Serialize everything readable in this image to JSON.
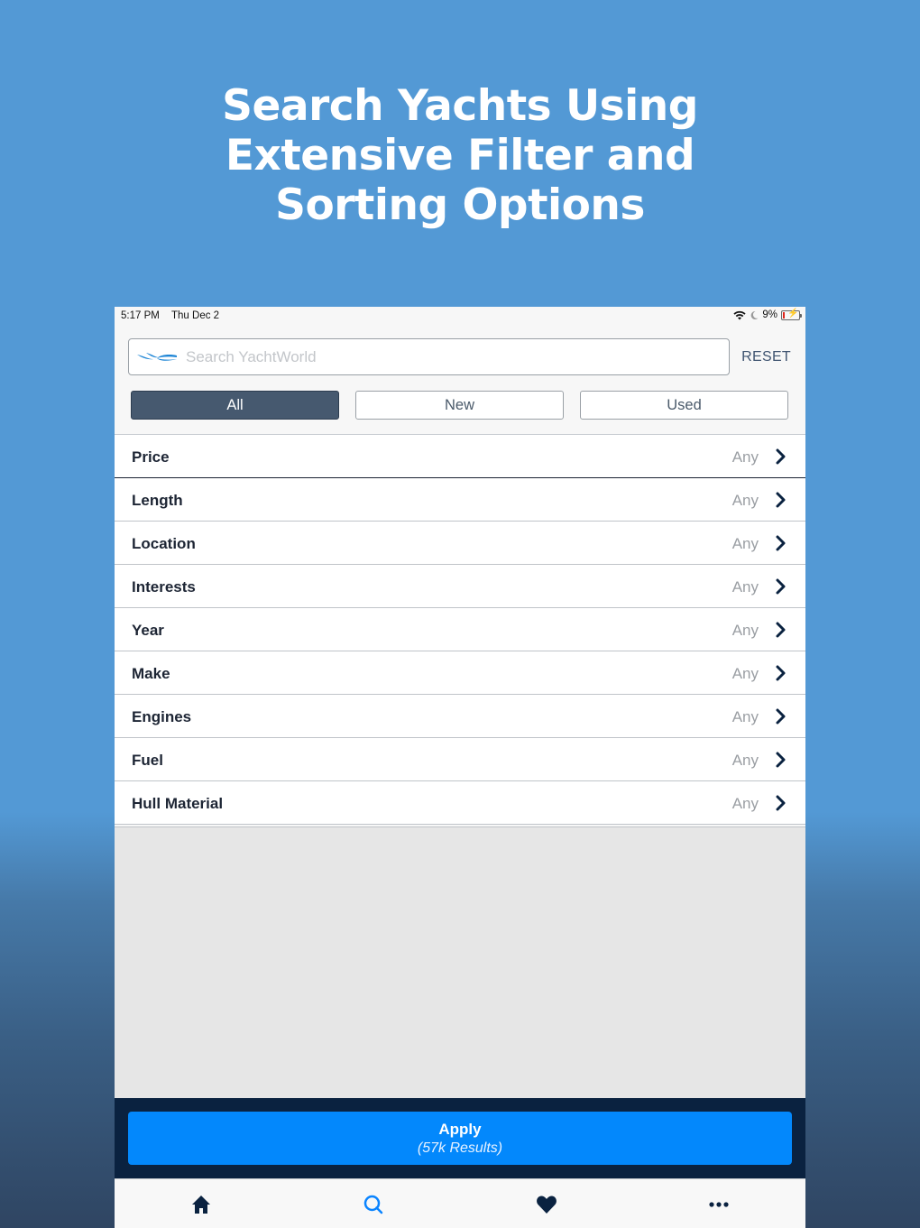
{
  "headline": {
    "line1": "Search Yachts Using",
    "line2": "Extensive Filter and",
    "line3": "Sorting Options"
  },
  "status_bar": {
    "time": "5:17 PM",
    "date": "Thu Dec 2",
    "battery": "9%",
    "icons": [
      "wifi-icon",
      "moon-icon",
      "battery-charging-icon"
    ]
  },
  "search": {
    "placeholder": "Search YachtWorld",
    "value": "",
    "logo": "yachtworld-logo"
  },
  "reset_label": "RESET",
  "segments": [
    {
      "label": "All",
      "active": true
    },
    {
      "label": "New",
      "active": false
    },
    {
      "label": "Used",
      "active": false
    }
  ],
  "filters": [
    {
      "label": "Price",
      "value": "Any"
    },
    {
      "label": "Length",
      "value": "Any"
    },
    {
      "label": "Location",
      "value": "Any"
    },
    {
      "label": "Interests",
      "value": "Any"
    },
    {
      "label": "Year",
      "value": "Any"
    },
    {
      "label": "Make",
      "value": "Any"
    },
    {
      "label": "Engines",
      "value": "Any"
    },
    {
      "label": "Fuel",
      "value": "Any"
    },
    {
      "label": "Hull Material",
      "value": "Any"
    }
  ],
  "apply": {
    "label": "Apply",
    "results": "(57k Results)"
  },
  "tabbar": {
    "items": [
      {
        "icon": "home-icon",
        "active": false
      },
      {
        "icon": "search-icon",
        "active": true
      },
      {
        "icon": "heart-icon",
        "active": false
      },
      {
        "icon": "more-icon",
        "active": false
      }
    ]
  },
  "colors": {
    "background": "#5399d5",
    "accent": "#0388fc",
    "navy": "#0a2240",
    "segment_active": "#46596f"
  }
}
